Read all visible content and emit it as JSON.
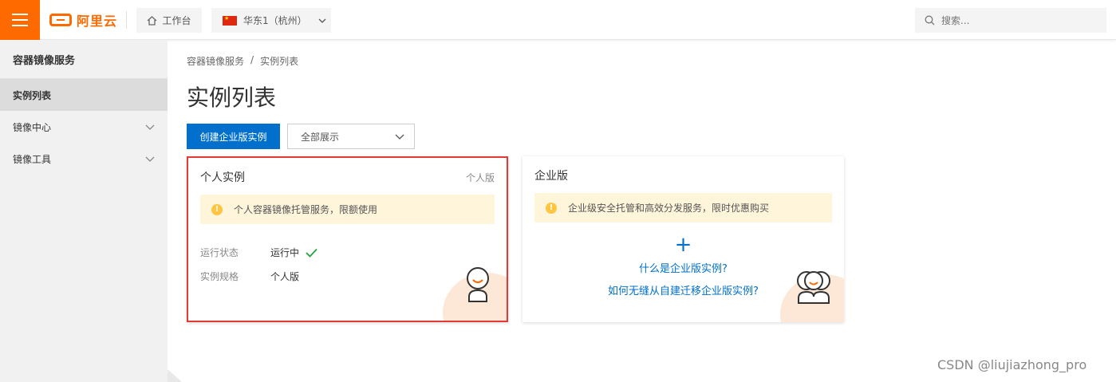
{
  "topbar": {
    "brand": "阿里云",
    "workbench_label": "工作台",
    "region_label": "华东1（杭州）",
    "search_placeholder": "搜索..."
  },
  "sidebar": {
    "title": "容器镜像服务",
    "items": [
      {
        "label": "实例列表",
        "active": true
      },
      {
        "label": "镜像中心",
        "expandable": true
      },
      {
        "label": "镜像工具",
        "expandable": true
      }
    ]
  },
  "breadcrumb": [
    "容器镜像服务",
    "/",
    "实例列表"
  ],
  "page_title": "实例列表",
  "toolbar": {
    "create_label": "创建企业版实例",
    "filter_value": "全部展示"
  },
  "cards": {
    "personal": {
      "title": "个人实例",
      "tag": "个人版",
      "notice": "个人容器镜像托管服务，限额使用",
      "status_label": "运行状态",
      "status_value": "运行中",
      "spec_label": "实例规格",
      "spec_value": "个人版"
    },
    "enterprise": {
      "title": "企业版",
      "notice": "企业级安全托管和高效分发服务，限时优惠购买",
      "plus": "+",
      "link1": "什么是企业版实例?",
      "link2": "如何无缝从自建迁移企业版实例?"
    }
  },
  "watermark": "CSDN @liujiazhong_pro",
  "colors": {
    "brand": "#ff6a00",
    "primary": "#0070cc",
    "highlight_border": "#e53935",
    "notice_bg": "#fff5db",
    "success": "#22a63a"
  }
}
